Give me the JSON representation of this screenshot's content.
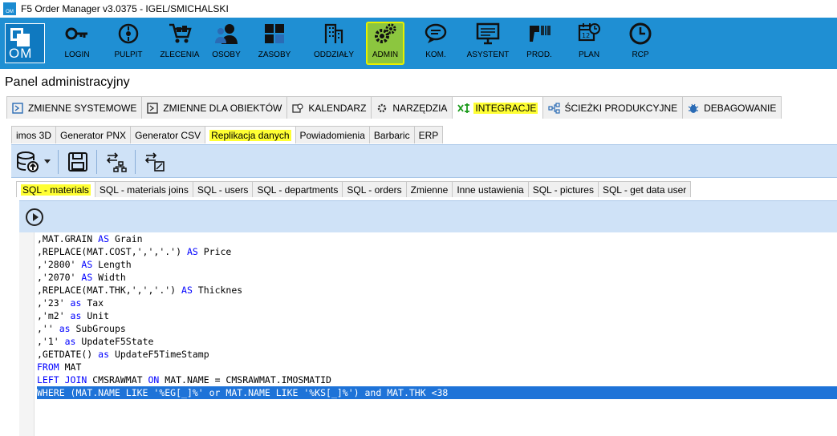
{
  "window": {
    "title": "F5 Order Manager v3.0375 - IGEL/SMICHALSKI",
    "app_icon_text": "OM"
  },
  "ribbon": {
    "logo_text": "OM",
    "items": [
      {
        "label": "LOGIN",
        "icon": "key-icon"
      },
      {
        "label": "PULPIT",
        "icon": "dashboard-icon"
      },
      {
        "label": "ZLECENIA",
        "icon": "cart-icon"
      },
      {
        "label": "OSOBY",
        "icon": "people-icon"
      },
      {
        "label": "ZASOBY",
        "icon": "resources-icon"
      },
      {
        "label": "ODDZIAŁY",
        "icon": "building-icon"
      },
      {
        "label": "ADMIN",
        "icon": "gears-icon"
      },
      {
        "label": "KOM.",
        "icon": "chat-icon"
      },
      {
        "label": "ASYSTENT",
        "icon": "monitor-icon"
      },
      {
        "label": "PROD.",
        "icon": "barcode-scanner-icon"
      },
      {
        "label": "PLAN",
        "icon": "calendar-clock-icon"
      },
      {
        "label": "RCP",
        "icon": "clock-icon"
      }
    ],
    "active": "ADMIN",
    "colors": {
      "ribbon": "#1f8fd3",
      "active_bg": "#8cc63f",
      "highlight": "#ffff33"
    }
  },
  "panel_title": "Panel administracyjny",
  "main_tabs": [
    {
      "label": "ZMIENNE SYSTEMOWE",
      "icon": "variables-icon"
    },
    {
      "label": "ZMIENNE DLA OBIEKTÓW",
      "icon": "object-variables-icon"
    },
    {
      "label": "KALENDARZ",
      "icon": "calendar-icon"
    },
    {
      "label": "NARZĘDZIA",
      "icon": "tools-icon"
    },
    {
      "label": "INTEGRACJE",
      "icon": "integration-icon"
    },
    {
      "label": "ŚCIEŻKI PRODUKCYJNE",
      "icon": "paths-icon"
    },
    {
      "label": "DEBAGOWANIE",
      "icon": "bug-icon"
    }
  ],
  "integration_tabs": [
    "imos 3D",
    "Generator PNX",
    "Generator CSV",
    "Replikacja danych",
    "Powiadomienia",
    "Barbaric",
    "ERP"
  ],
  "sql_tabs": [
    "SQL - materials",
    "SQL - materials joins",
    "SQL - users",
    "SQL - departments",
    "SQL - orders",
    "Zmienne",
    "Inne ustawienia",
    "SQL - pictures",
    "SQL - get data user"
  ],
  "toolbar": {
    "icons": [
      "database-upload-icon",
      "dropdown-arrow-icon",
      "save-icon",
      "sync-structure-icon",
      "sync-file-icon"
    ]
  },
  "editor": {
    "run_icon": "play-icon",
    "lines": [
      [
        ",MAT.GRAIN ",
        {
          "k": "AS"
        },
        " Grain"
      ],
      [
        ",REPLACE(MAT.COST,',','.') ",
        {
          "k": "AS"
        },
        " Price"
      ],
      [
        ",'2800' ",
        {
          "k": "AS"
        },
        " Length"
      ],
      [
        ",'2070' ",
        {
          "k": "AS"
        },
        " Width"
      ],
      [
        ",REPLACE(MAT.THK,',','.') ",
        {
          "k": "AS"
        },
        " Thicknes"
      ],
      [
        ",'23' ",
        {
          "k": "as"
        },
        " Tax"
      ],
      [
        ",'m2' ",
        {
          "k": "as"
        },
        " Unit"
      ],
      [
        ",'' ",
        {
          "k": "as"
        },
        " SubGroups"
      ],
      [
        ",'1' ",
        {
          "k": "as"
        },
        " UpdateF5State"
      ],
      [
        ",GETDATE() ",
        {
          "k": "as"
        },
        " UpdateF5TimeStamp"
      ],
      [
        {
          "k": "FROM"
        },
        " MAT"
      ],
      [
        {
          "k": "LEFT JOIN"
        },
        " CMSRAWMAT ",
        {
          "k": "ON"
        },
        " MAT.NAME = CMSRAWMAT.IMOSMATID"
      ],
      [
        {
          "k": "WHERE"
        },
        " (MAT.NAME LIKE '%EG[_]%' or MAT.NAME LIKE '%KS[_]%') and MAT.THK <38"
      ]
    ],
    "selected_line": 12
  }
}
